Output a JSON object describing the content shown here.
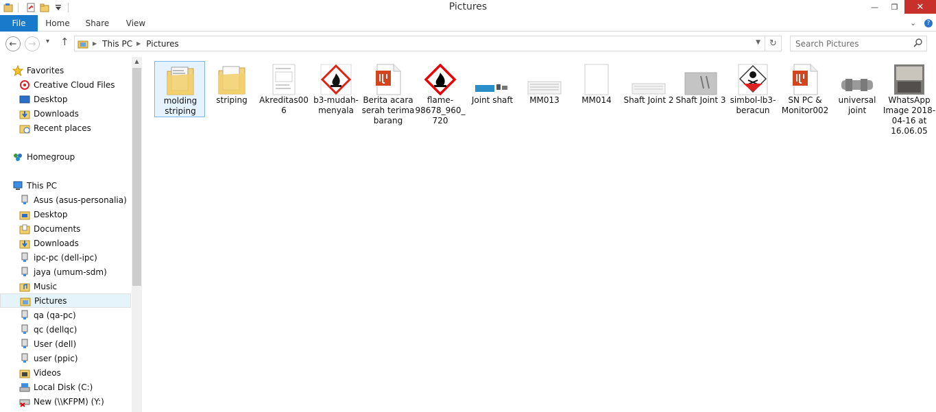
{
  "window": {
    "title": "Pictures",
    "minimize": "—",
    "restore": "❐",
    "close": "✕"
  },
  "ribbon": {
    "tabs": [
      "File",
      "Home",
      "Share",
      "View"
    ],
    "collapse": "⌄",
    "help": "?"
  },
  "nav": {
    "back": "←",
    "forward": "→",
    "recent": "▾",
    "up": "↑"
  },
  "address": {
    "crumbs": [
      "This PC",
      "Pictures"
    ]
  },
  "search": {
    "placeholder": "Search Pictures"
  },
  "sidebar": {
    "favorites": {
      "label": "Favorites",
      "items": [
        "Creative Cloud Files",
        "Desktop",
        "Downloads",
        "Recent places"
      ]
    },
    "homegroup": {
      "label": "Homegroup"
    },
    "thispc": {
      "label": "This PC",
      "items": [
        "Asus (asus-personalia)",
        "Desktop",
        "Documents",
        "Downloads",
        "ipc-pc (dell-ipc)",
        "jaya (umum-sdm)",
        "Music",
        "Pictures",
        "qa (qa-pc)",
        "qc (dellqc)",
        "User (dell)",
        "user (ppic)",
        "Videos",
        "Local Disk (C:)",
        "New (\\\\KFPM) (Y:)"
      ]
    }
  },
  "files": [
    {
      "name": "molding striping",
      "kind": "folder"
    },
    {
      "name": "striping",
      "kind": "folder"
    },
    {
      "name": "Akreditas006",
      "kind": "doc"
    },
    {
      "name": "b3-mudah-menyala",
      "kind": "flame"
    },
    {
      "name": "Berita acara serah terima barang",
      "kind": "pdf"
    },
    {
      "name": "flame-98678_960_720",
      "kind": "flame"
    },
    {
      "name": "Joint shaft",
      "kind": "part"
    },
    {
      "name": "MM013",
      "kind": "scan"
    },
    {
      "name": "MM014",
      "kind": "blank"
    },
    {
      "name": "Shaft Joint 2",
      "kind": "scan"
    },
    {
      "name": "Shaft Joint 3",
      "kind": "photo"
    },
    {
      "name": "simbol-lb3-beracun",
      "kind": "toxic"
    },
    {
      "name": "SN PC & Monitor002",
      "kind": "pdf"
    },
    {
      "name": "universal joint",
      "kind": "joint"
    },
    {
      "name": "WhatsApp Image 2018-04-16 at 16.06.05",
      "kind": "whatsapp"
    }
  ]
}
